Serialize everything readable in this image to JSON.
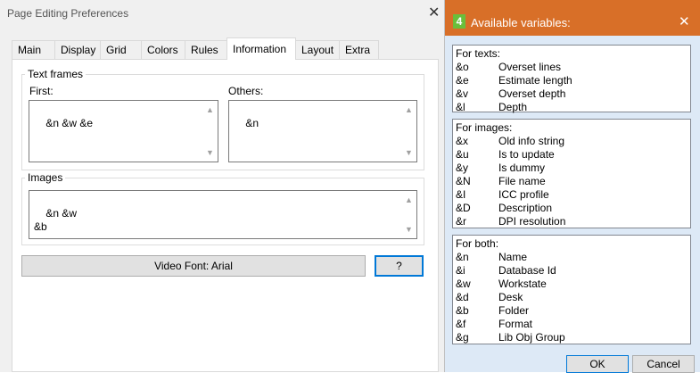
{
  "main_window": {
    "title": "Page Editing Preferences",
    "tabs": [
      "Main",
      "Display",
      "Grid",
      "Colors",
      "Rules",
      "Information",
      "Layout",
      "Extra"
    ],
    "active_tab": "Information",
    "text_frames": {
      "group_label": "Text frames",
      "first_label": "First:",
      "first_value": "&n &w &e",
      "others_label": "Others:",
      "others_value": "&n"
    },
    "images": {
      "group_label": "Images",
      "value": "&n &w\n&b"
    },
    "video_font_button": "Video Font: Arial",
    "help_button": "?"
  },
  "variables_dialog": {
    "title": "Available variables:",
    "app_icon": "4",
    "sections": [
      {
        "heading": "For texts:",
        "items": [
          {
            "code": "&o",
            "desc": "Overset lines"
          },
          {
            "code": "&e",
            "desc": "Estimate length"
          },
          {
            "code": "&v",
            "desc": "Overset depth"
          },
          {
            "code": "&l",
            "desc": "Depth"
          }
        ]
      },
      {
        "heading": "For images:",
        "items": [
          {
            "code": "&x",
            "desc": "Old info string"
          },
          {
            "code": "&u",
            "desc": "Is to update"
          },
          {
            "code": "&y",
            "desc": "Is dummy"
          },
          {
            "code": "&N",
            "desc": "File name"
          },
          {
            "code": "&I",
            "desc": "ICC profile"
          },
          {
            "code": "&D",
            "desc": "Description"
          },
          {
            "code": "&r",
            "desc": "DPI resolution"
          }
        ]
      },
      {
        "heading": "For both:",
        "items": [
          {
            "code": "&n",
            "desc": "Name"
          },
          {
            "code": "&i",
            "desc": "Database Id"
          },
          {
            "code": "&w",
            "desc": "Workstate"
          },
          {
            "code": "&d",
            "desc": "Desk"
          },
          {
            "code": "&b",
            "desc": "Folder"
          },
          {
            "code": "&f",
            "desc": "Format"
          },
          {
            "code": "&g",
            "desc": "Lib Obj Group"
          }
        ]
      }
    ],
    "ok_button": "OK",
    "cancel_button": "Cancel"
  },
  "colors": {
    "dialog_titlebar": "#d86f28",
    "dialog_background": "#dde9f6",
    "focus_border": "#0078d7"
  }
}
